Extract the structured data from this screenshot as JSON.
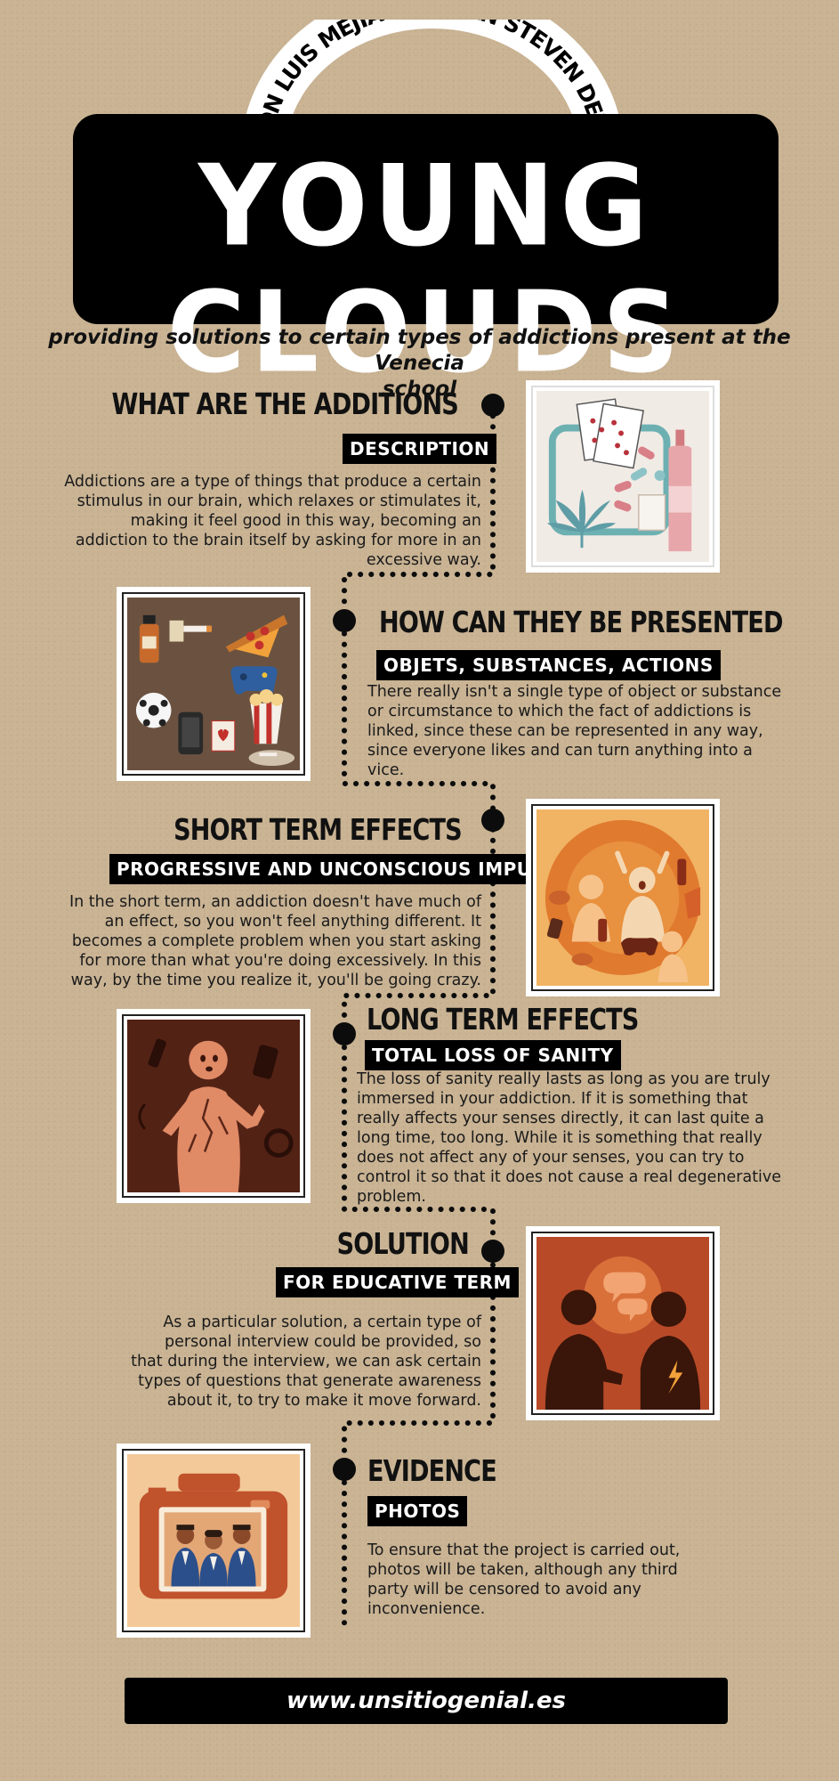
{
  "header": {
    "authors": "JHON LUIS MEJIA Y FABIAN STEVEN DEVIA",
    "title": "YOUNG CLOUDS",
    "subtitle_line1": "providing solutions to certain types of addictions present at the Venecia",
    "subtitle_line2": "school"
  },
  "sections": [
    {
      "heading": "WHAT ARE THE ADDITIONS",
      "tag": "DESCRIPTION",
      "lines": [
        "Addictions are a type of things that produce a certain",
        "stimulus in our brain, which relaxes or stimulates it,",
        "making it feel good in this way, becoming an",
        "addiction to the brain itself by asking for more in an",
        "excessive way."
      ],
      "icon": "cards-pills-bottle-icon"
    },
    {
      "heading": "HOW CAN THEY BE PRESENTED",
      "tag": "OBJETS, SUBSTANCES, ACTIONS",
      "lines": [
        "There really isn't a single type of object or substance",
        "or circumstance to which the fact of addictions is",
        "linked, since these can be represented in any way,",
        "since everyone likes and can turn anything into a",
        "vice."
      ],
      "icon": "objects-collage-icon"
    },
    {
      "heading": "SHORT TERM EFFECTS",
      "tag": "PROGRESSIVE AND UNCONSCIOUS IMPULSE",
      "lines": [
        "In the short term, an addiction doesn't have much of",
        "an effect, so you won't feel anything different. It",
        "becomes a complete problem when you start asking",
        "for more than what you're doing excessively. In this",
        "way, by the time you realize it, you'll be going crazy."
      ],
      "icon": "anxious-people-icon"
    },
    {
      "heading": "LONG TERM EFFECTS",
      "tag": "TOTAL LOSS OF SANITY",
      "lines": [
        "The loss of sanity really lasts as long as you are truly",
        "immersed in your addiction. If it is something that",
        "really affects your senses directly, it can last quite a",
        "long time, too long. While it is something that really",
        "does not affect any of your senses, you can try to",
        "control it so that it does not cause a real degenerative",
        "problem."
      ],
      "icon": "cracked-figure-icon"
    },
    {
      "heading": "SOLUTION",
      "tag": "FOR EDUCATIVE TERM",
      "lines": [
        "As a particular solution, a certain type of",
        "personal interview could be provided, so",
        "that during the interview, we can ask certain",
        "types of questions that generate awareness",
        "about it, to try to make it move forward."
      ],
      "icon": "interview-silhouettes-icon"
    },
    {
      "heading": "EVIDENCE",
      "tag": "PHOTOS",
      "lines": [
        "To ensure that the project is carried out,",
        "photos will be taken, although any third",
        "party will be censored to avoid any",
        "inconvenience."
      ],
      "icon": "camera-students-icon"
    }
  ],
  "footer": {
    "url": "www.unsitiogenial.es"
  },
  "colors": {
    "background": "#c9b393",
    "ink": "#000000",
    "paper": "#ffffff"
  }
}
